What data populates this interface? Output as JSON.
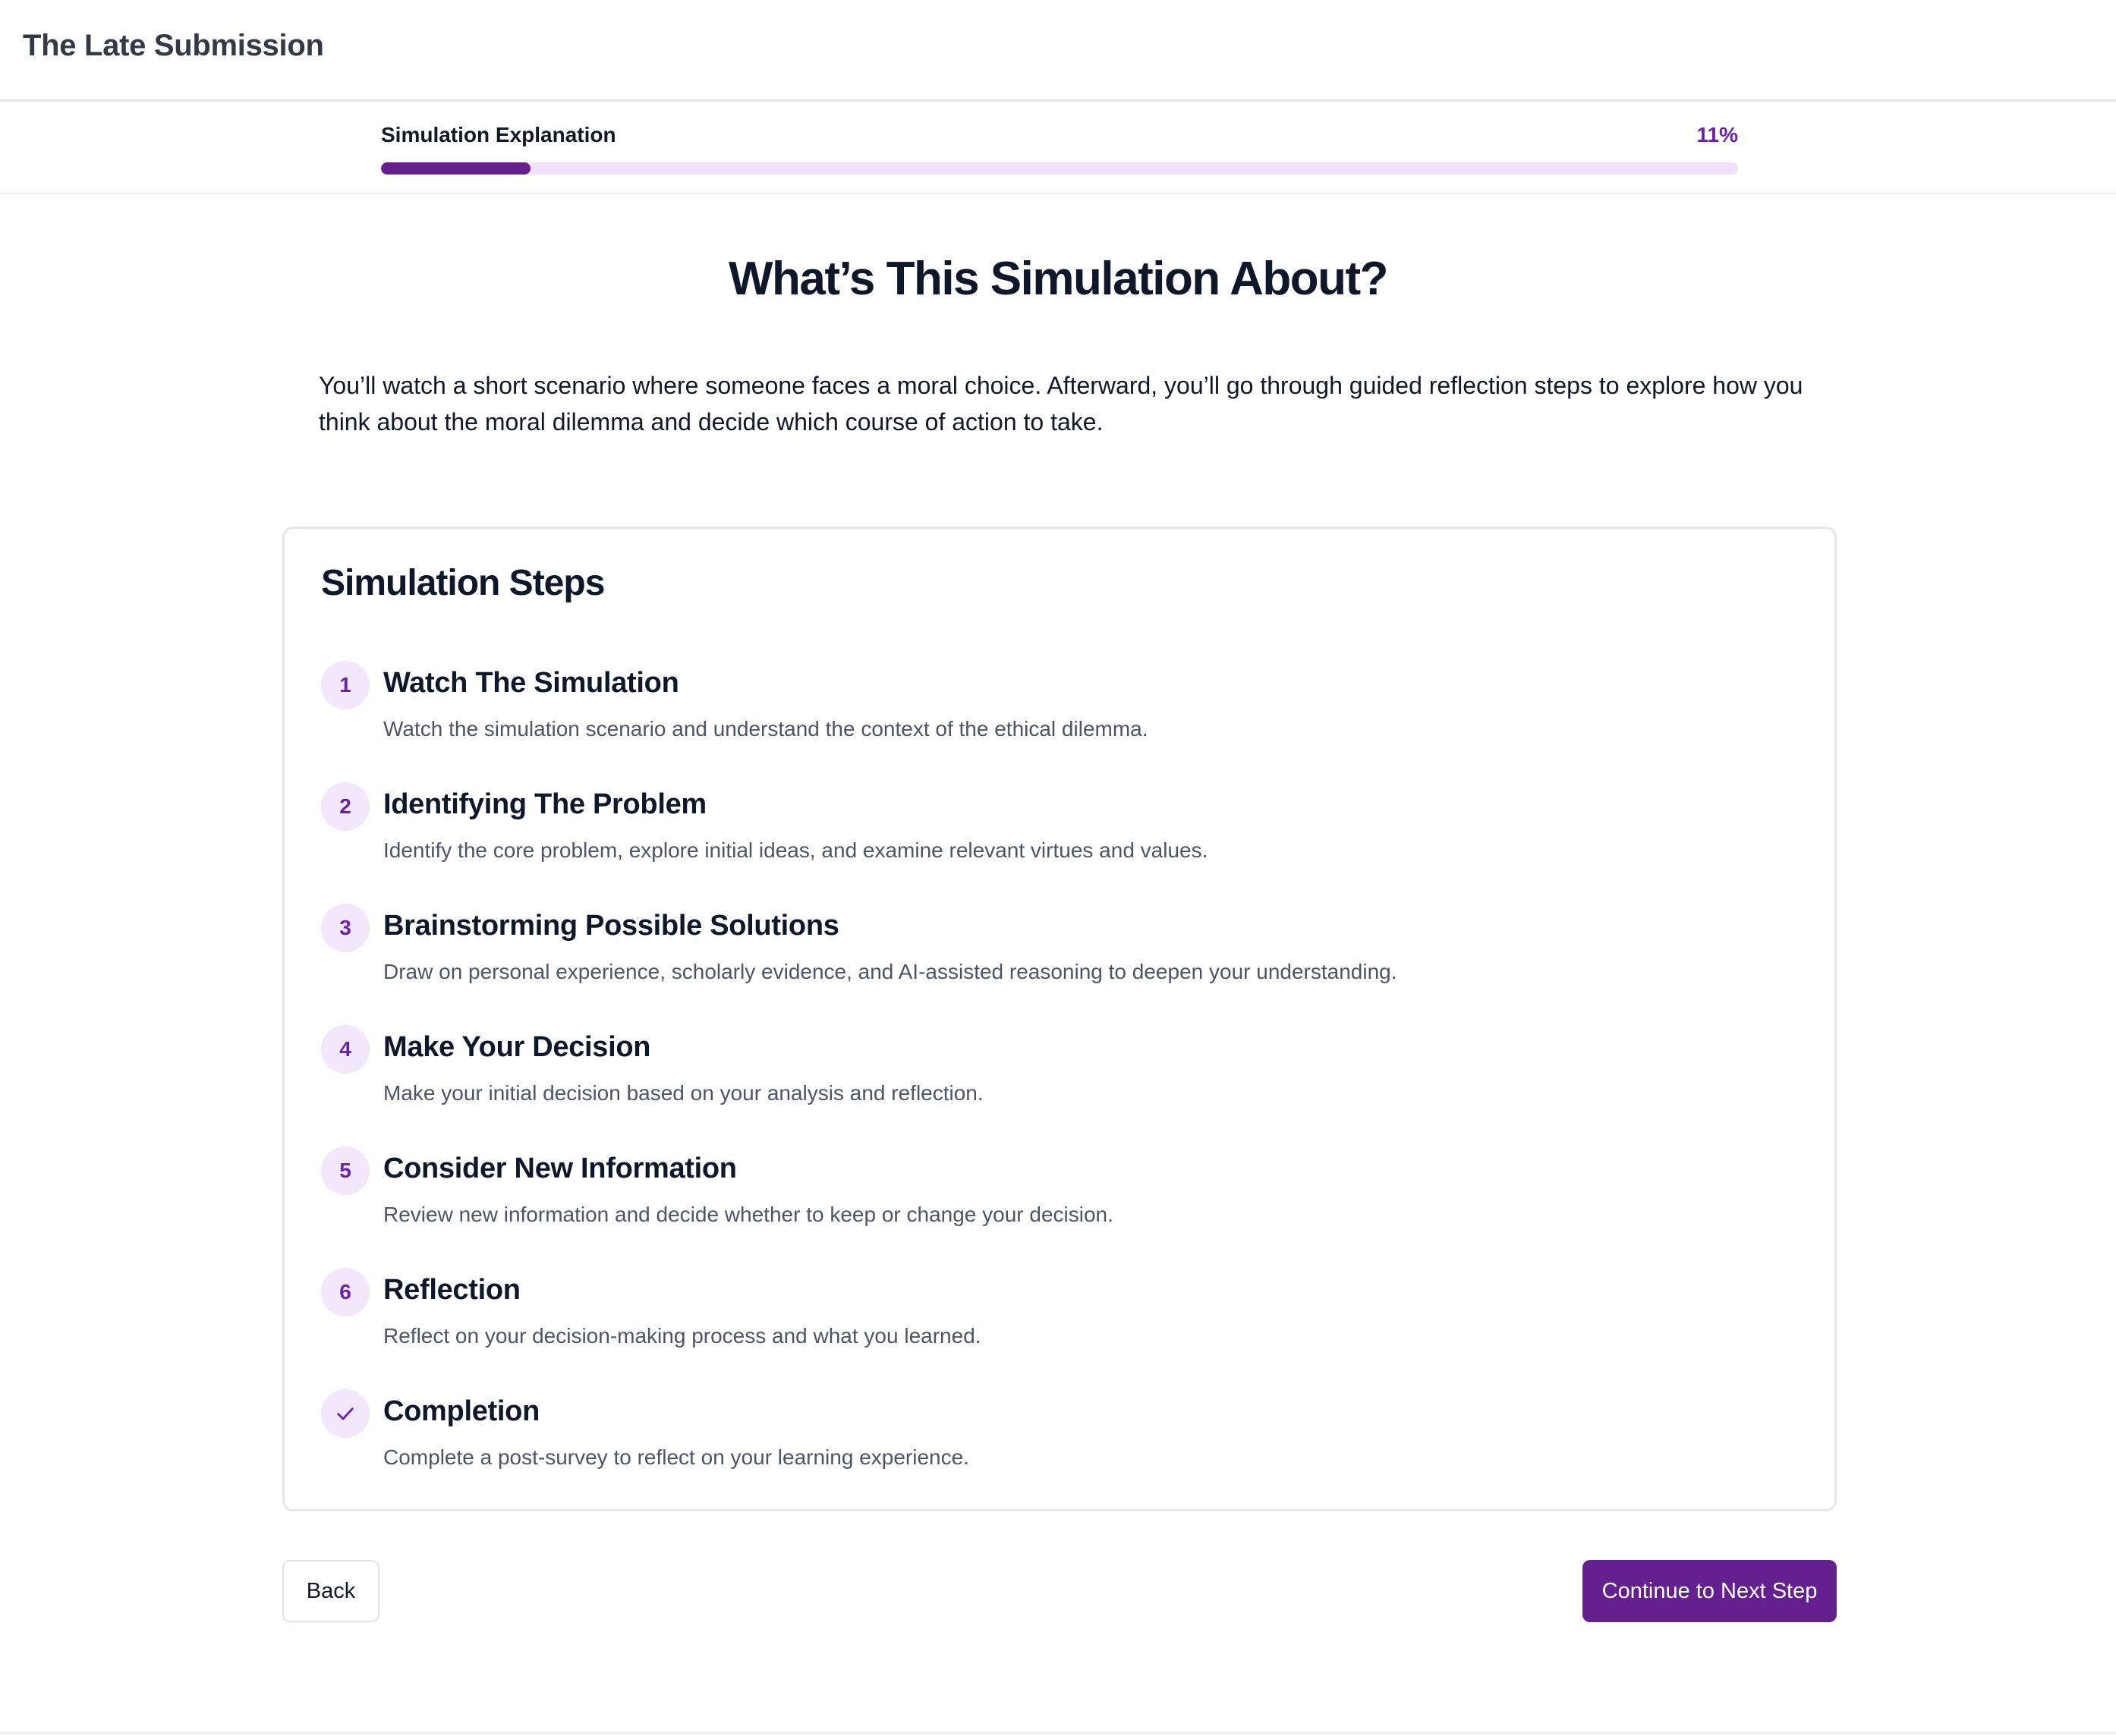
{
  "header": {
    "title": "The Late Submission"
  },
  "progress": {
    "label": "Simulation Explanation",
    "percent_text": "11%",
    "value": 0.11
  },
  "main": {
    "title": "What’s This Simulation About?",
    "intro": "You’ll watch a short scenario where someone faces a moral choice. Afterward, you’ll go through guided reflection steps to explore how you think about the moral dilemma and decide which course of action to take."
  },
  "steps_card": {
    "title": "Simulation Steps",
    "items": [
      {
        "num": "1",
        "title": "Watch The Simulation",
        "desc": "Watch the simulation scenario and understand the context of the ethical dilemma."
      },
      {
        "num": "2",
        "title": "Identifying The Problem",
        "desc": "Identify the core problem, explore initial ideas, and examine relevant virtues and values."
      },
      {
        "num": "3",
        "title": "Brainstorming Possible Solutions",
        "desc": "Draw on personal experience, scholarly evidence, and AI-assisted reasoning to deepen your understanding."
      },
      {
        "num": "4",
        "title": "Make Your Decision",
        "desc": "Make your initial decision based on your analysis and reflection."
      },
      {
        "num": "5",
        "title": "Consider New Information",
        "desc": "Review new information and decide whether to keep or change your decision."
      },
      {
        "num": "6",
        "title": "Reflection",
        "desc": "Reflect on your decision-making process and what you learned."
      },
      {
        "num": "✓",
        "title": "Completion",
        "desc": "Complete a post-survey to reflect on your learning experience.",
        "icon": "check-icon"
      }
    ]
  },
  "actions": {
    "back_label": "Back",
    "continue_label": "Continue to Next Step"
  },
  "colors": {
    "accent": "#64208f",
    "accent_light": "#f0e0fb",
    "step_circle_bg": "#f3e8fb"
  }
}
